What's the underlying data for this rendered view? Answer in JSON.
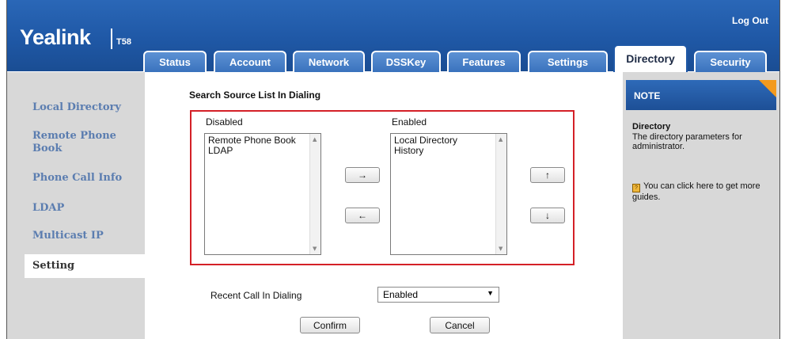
{
  "header": {
    "logo": "Yealink",
    "model": "T58",
    "logout_label": "Log Out"
  },
  "tabs": [
    {
      "label": "Status"
    },
    {
      "label": "Account"
    },
    {
      "label": "Network"
    },
    {
      "label": "DSSKey"
    },
    {
      "label": "Features"
    },
    {
      "label": "Settings"
    },
    {
      "label": "Directory",
      "active": true
    },
    {
      "label": "Security"
    }
  ],
  "sidebar": {
    "items": [
      {
        "label": "Local Directory"
      },
      {
        "label": "Remote Phone Book"
      },
      {
        "label": "Phone Call Info"
      },
      {
        "label": "LDAP"
      },
      {
        "label": "Multicast IP"
      },
      {
        "label": "Setting",
        "selected": true
      }
    ]
  },
  "main": {
    "section_title": "Search Source List In Dialing",
    "disabled_label": "Disabled",
    "enabled_label": "Enabled",
    "disabled_items": [
      "Remote Phone Book",
      "LDAP"
    ],
    "enabled_items": [
      "Local Directory",
      "History"
    ],
    "move_right_glyph": "→",
    "move_left_glyph": "←",
    "move_up_glyph": "↑",
    "move_down_glyph": "↓",
    "recent_call_label": "Recent Call In Dialing",
    "recent_call_value": "Enabled",
    "confirm_label": "Confirm",
    "cancel_label": "Cancel"
  },
  "note": {
    "heading": "NOTE",
    "title": "Directory",
    "body": "The directory parameters for administrator.",
    "guide": "You can click here to get more guides."
  },
  "colors": {
    "header_blue": "#1f58a6",
    "highlight_red": "#d42027",
    "note_corner_orange": "#f39a1e",
    "nav_text": "#5b7db0"
  }
}
